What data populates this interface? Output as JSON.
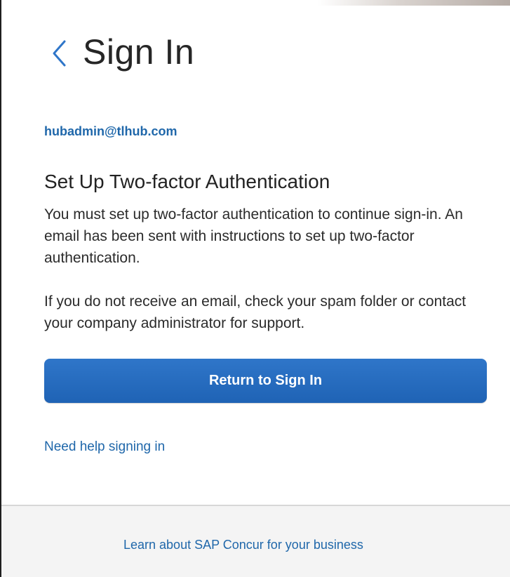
{
  "header": {
    "title": "Sign In",
    "back_icon": "chevron-left-icon",
    "back_icon_color": "#2f76c9"
  },
  "account": {
    "email": "hubadmin@tlhub.com"
  },
  "content": {
    "heading": "Set Up Two-factor Authentication",
    "paragraph_1": "You must set up two-factor authentication to continue sign-in. An email has been sent with instructions to set up two-factor authentication.",
    "paragraph_2": "If you do not receive an email, check your spam folder or contact your company administrator for support."
  },
  "actions": {
    "primary_label": "Return to Sign In",
    "help_link": "Need help signing in"
  },
  "footer": {
    "link": "Learn about SAP Concur for your business"
  },
  "colors": {
    "link": "#1f67aa",
    "primary_button": "#2a6fc1",
    "footer_background": "#f4f4f4"
  }
}
